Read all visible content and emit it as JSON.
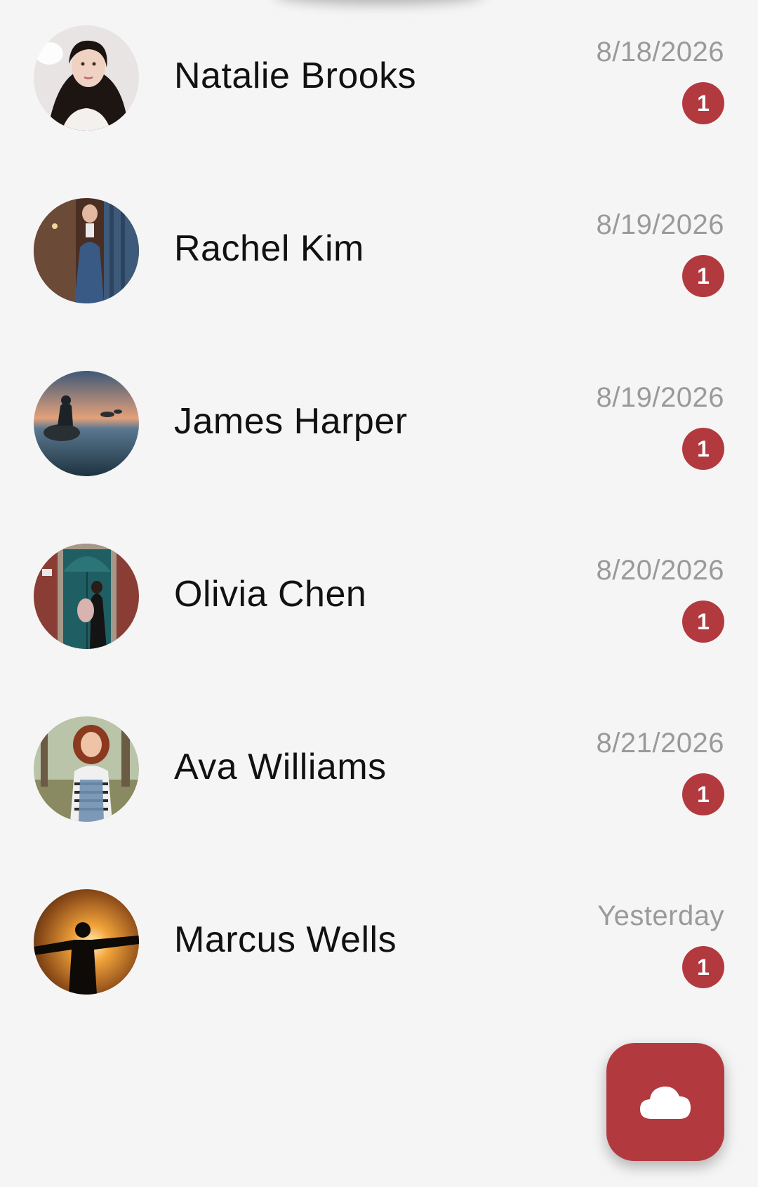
{
  "conversations": [
    {
      "name": "Natalie Brooks",
      "date": "8/18/2026",
      "unread": "1",
      "avatar": "portrait-woman-dark-hair"
    },
    {
      "name": "Rachel Kim",
      "date": "8/19/2026",
      "unread": "1",
      "avatar": "woman-denim-doorway"
    },
    {
      "name": "James Harper",
      "date": "8/19/2026",
      "unread": "1",
      "avatar": "person-on-rock-seascape"
    },
    {
      "name": "Olivia Chen",
      "date": "8/20/2026",
      "unread": "1",
      "avatar": "woman-teal-door"
    },
    {
      "name": "Ava Williams",
      "date": "8/21/2026",
      "unread": "1",
      "avatar": "woman-curly-hair-overalls"
    },
    {
      "name": "Marcus Wells",
      "date": "Yesterday",
      "unread": "1",
      "avatar": "man-sunset-silhouette"
    }
  ],
  "fab": {
    "icon": "cloud-icon"
  },
  "colors": {
    "accent": "#b23a3f",
    "background": "#f5f5f5",
    "name_text": "#111111",
    "date_text": "#9a9a9a"
  }
}
